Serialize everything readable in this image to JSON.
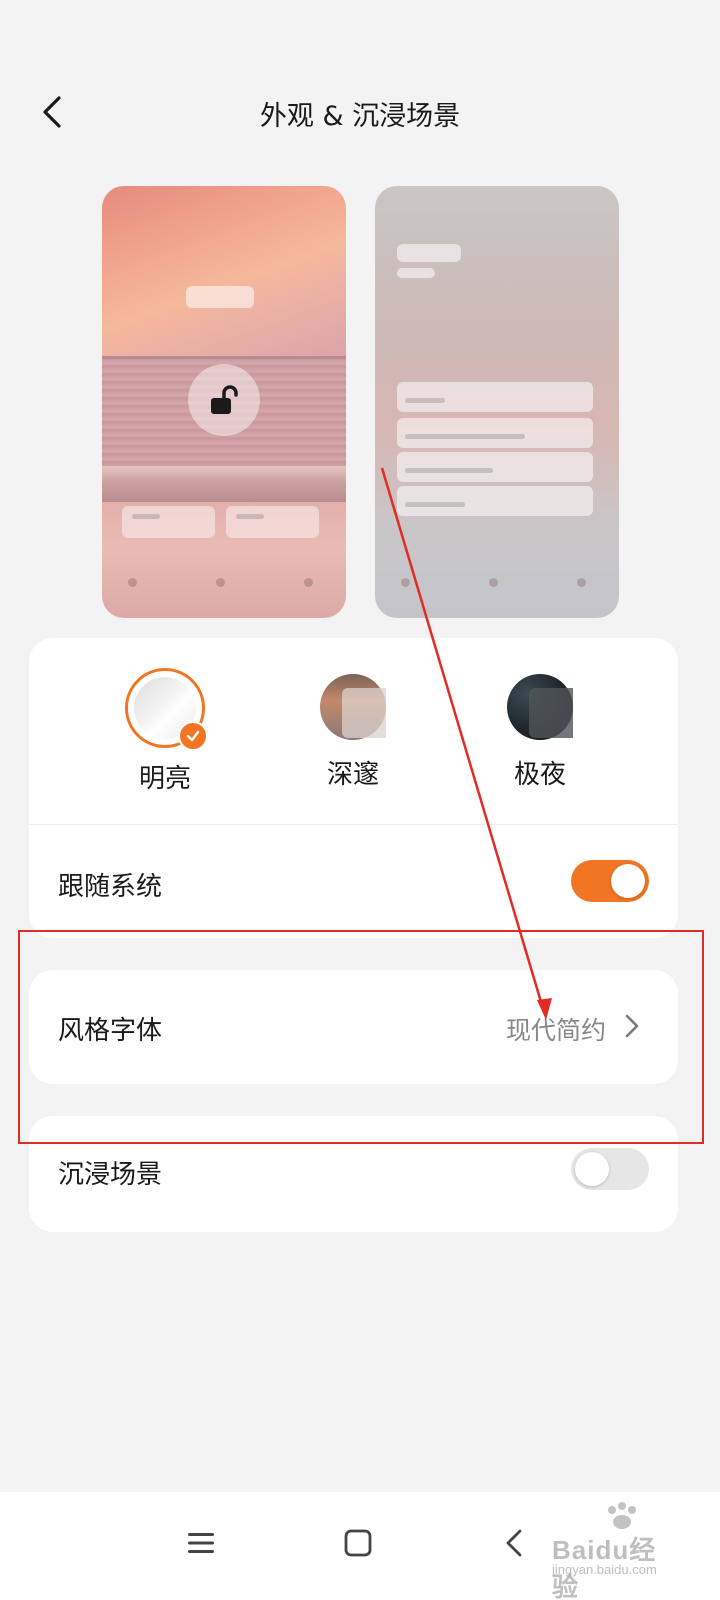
{
  "header": {
    "title": "外观 & 沉浸场景"
  },
  "themes": [
    {
      "label": "明亮",
      "selected": true
    },
    {
      "label": "深邃",
      "selected": false
    },
    {
      "label": "极夜",
      "selected": false
    }
  ],
  "settings": {
    "follow_system": {
      "label": "跟随系统",
      "on": true
    },
    "font_style": {
      "label": "风格字体",
      "value": "现代简约"
    },
    "immersive_scene": {
      "label": "沉浸场景",
      "on": false
    }
  },
  "colors": {
    "accent": "#f27524",
    "annotation": "#e32b25",
    "background": "#f3f3f3"
  },
  "watermark": {
    "text": "Baidu经验",
    "sub": "jingyan.baidu.com"
  }
}
